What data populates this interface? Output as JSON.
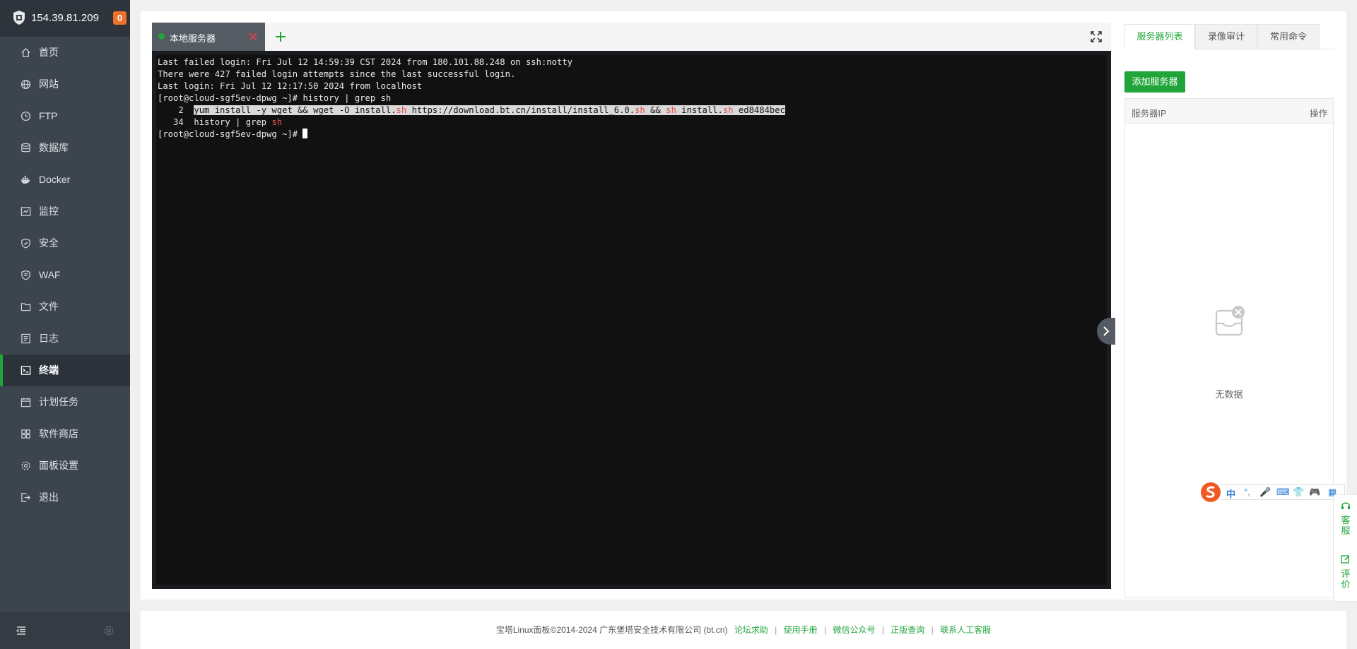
{
  "sidebar": {
    "host_ip": "154.39.81.209",
    "notice_count": "0",
    "items": [
      {
        "label": "首页",
        "icon": "home-icon"
      },
      {
        "label": "网站",
        "icon": "globe-icon"
      },
      {
        "label": "FTP",
        "icon": "ftp-icon"
      },
      {
        "label": "数据库",
        "icon": "database-icon"
      },
      {
        "label": "Docker",
        "icon": "docker-icon"
      },
      {
        "label": "监控",
        "icon": "monitor-icon"
      },
      {
        "label": "安全",
        "icon": "shield-icon"
      },
      {
        "label": "WAF",
        "icon": "waf-icon"
      },
      {
        "label": "文件",
        "icon": "folder-icon"
      },
      {
        "label": "日志",
        "icon": "log-icon"
      },
      {
        "label": "终端",
        "icon": "terminal-icon",
        "active": true
      },
      {
        "label": "计划任务",
        "icon": "calendar-icon"
      },
      {
        "label": "软件商店",
        "icon": "grid-icon"
      },
      {
        "label": "面板设置",
        "icon": "gear-icon"
      },
      {
        "label": "退出",
        "icon": "logout-icon"
      }
    ]
  },
  "terminal": {
    "tab_label": "本地服务器",
    "lines": {
      "l1": "Last failed login: Fri Jul 12 14:59:39 CST 2024 from 180.101.88.248 on ssh:notty",
      "l2": "There were 427 failed login attempts since the last successful login.",
      "l3": "Last login: Fri Jul 12 12:17:50 2024 from localhost",
      "l4": "[root@cloud-sgf5ev-dpwg ~]# history | grep sh",
      "l5_num": "    2  ",
      "l5_a": "yum install -y wget && wget -O install.",
      "l5_b": "sh",
      "l5_c": " https://download.bt.cn/install/install_6.0.",
      "l5_d": "sh",
      "l5_e": " && ",
      "l5_f": "sh",
      "l5_g": " install.",
      "l5_h": "sh",
      "l5_i": " ed8484bec",
      "l6_a": "   34  history | grep ",
      "l6_b": "sh",
      "l7": "[root@cloud-sgf5ev-dpwg ~]# "
    }
  },
  "right_panel": {
    "tabs": [
      "服务器列表",
      "录像审计",
      "常用命令"
    ],
    "add_button": "添加服务器",
    "col_ip": "服务器IP",
    "col_action": "操作",
    "empty_text": "无数据"
  },
  "ime": {
    "items": [
      "中",
      "°,",
      "🎤",
      "⌨",
      "👕",
      "🎮",
      "▦"
    ]
  },
  "side_widget": {
    "service": "客服",
    "review": "评价"
  },
  "footer": {
    "copyright": "宝塔Linux面板©2014-2024 广东堡塔安全技术有限公司 (bt.cn)",
    "links": [
      "论坛求助",
      "使用手册",
      "微信公众号",
      "正版查询",
      "联系人工客服"
    ]
  },
  "colors": {
    "brand_green": "#20a53a",
    "sidebar_bg": "#3c444d",
    "terminal_bg": "#111112",
    "highlight_red": "#ee5454"
  }
}
